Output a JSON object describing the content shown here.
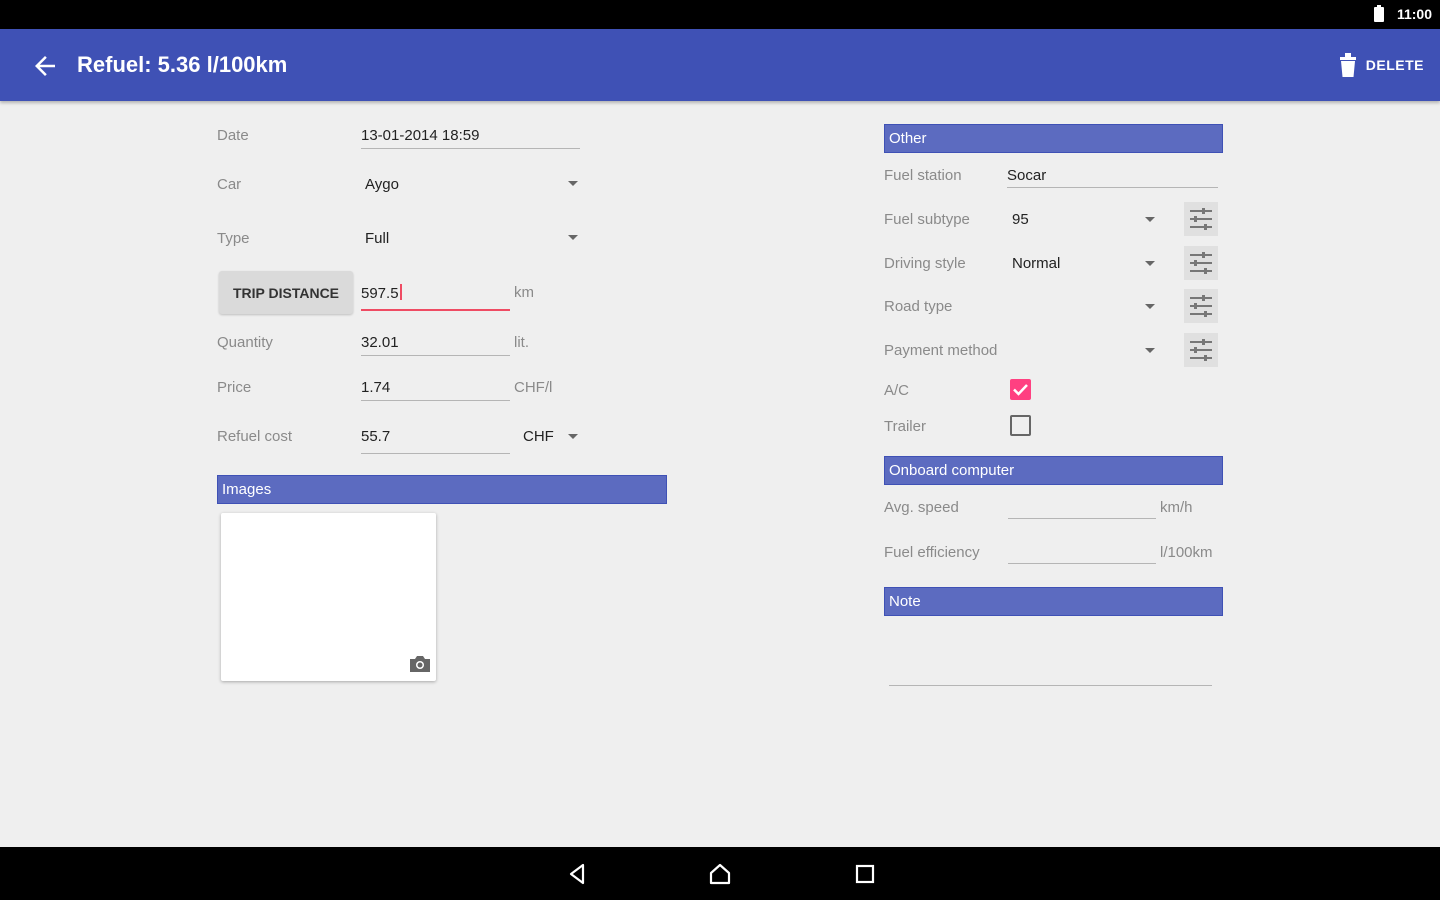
{
  "status": {
    "time": "11:00"
  },
  "toolbar": {
    "title": "Refuel: 5.36 l/100km",
    "delete_label": "DELETE"
  },
  "form": {
    "date": {
      "label": "Date",
      "value": "13-01-2014 18:59"
    },
    "car": {
      "label": "Car",
      "value": "Aygo"
    },
    "type": {
      "label": "Type",
      "value": "Full"
    },
    "trip": {
      "button_label": "TRIP DISTANCE",
      "value": "597.5",
      "unit": "km"
    },
    "quantity": {
      "label": "Quantity",
      "value": "32.01",
      "unit": "lit."
    },
    "price": {
      "label": "Price",
      "value": "1.74",
      "unit": "CHF/l"
    },
    "refuel_cost": {
      "label": "Refuel cost",
      "value": "55.7",
      "currency": "CHF"
    }
  },
  "images": {
    "header": "Images"
  },
  "other": {
    "header": "Other",
    "fuel_station": {
      "label": "Fuel station",
      "value": "Socar"
    },
    "fuel_subtype": {
      "label": "Fuel subtype",
      "value": "95"
    },
    "driving_style": {
      "label": "Driving style",
      "value": "Normal"
    },
    "road_type": {
      "label": "Road type",
      "value": ""
    },
    "payment_method": {
      "label": "Payment method",
      "value": ""
    },
    "ac": {
      "label": "A/C",
      "checked": true
    },
    "trailer": {
      "label": "Trailer",
      "checked": false
    }
  },
  "onboard": {
    "header": "Onboard computer",
    "avg_speed": {
      "label": "Avg. speed",
      "value": "",
      "unit": "km/h"
    },
    "fuel_efficiency": {
      "label": "Fuel efficiency",
      "value": "",
      "unit": "l/100km"
    }
  },
  "note": {
    "header": "Note",
    "value": ""
  },
  "colors": {
    "primary": "#3f51b5",
    "section": "#5c6bc0",
    "accent": "#ff4081"
  }
}
